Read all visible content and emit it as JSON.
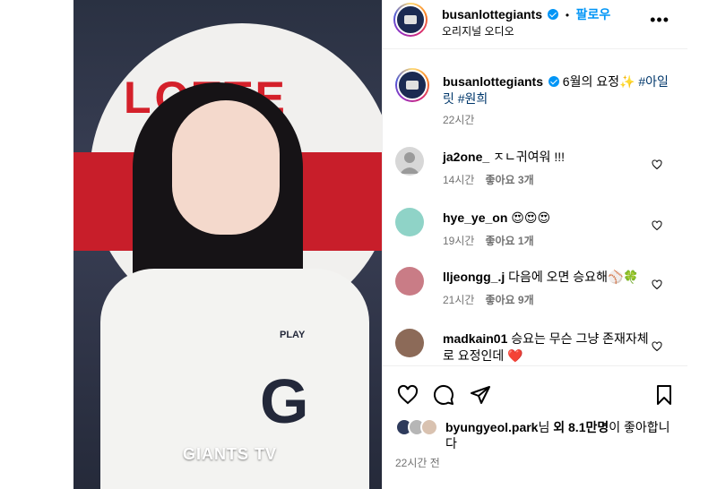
{
  "header": {
    "username": "busanlottegiants",
    "separator": "•",
    "follow_label": "팔로우",
    "audio_label": "오리지널 오디오",
    "more_label": "•••"
  },
  "media": {
    "sign_text": "LOTTE",
    "jersey_brand": "PLAY",
    "jersey_letter": "G",
    "watermark": "GIANTS TV"
  },
  "caption": {
    "username": "busanlottegiants",
    "text": "6월의 요정✨",
    "hashtags": "#아일릿 #원희",
    "time": "22시간"
  },
  "comments": [
    {
      "username": "ja2one_",
      "text": "ㅈㄴ귀여워 !!!",
      "time": "14시간",
      "likes": "좋아요 3개",
      "avatar_color": "#c7c7c7"
    },
    {
      "username": "hye_ye_on",
      "text": "😍😍😍",
      "time": "19시간",
      "likes": "좋아요 1개",
      "avatar_color": "#8fd3c7"
    },
    {
      "username": "lljeongg_.j",
      "text": "다음에 오면 승요해⚾🍀",
      "time": "21시간",
      "likes": "좋아요 9개",
      "avatar_color": "#c97c86"
    },
    {
      "username": "madkain01",
      "text": "승요는 무슨 그냥 존재자체로 요정인데 ❤️",
      "time": "",
      "likes": "",
      "avatar_color": "#8c6a58"
    }
  ],
  "liked_by": {
    "username": "byungyeol.park",
    "mid": "님 ",
    "count": "외 8.1만명",
    "suffix": "이 좋아합니다"
  },
  "posted_time": "22시간 전",
  "colors": {
    "accent": "#0095f6",
    "hashtag": "#00376b",
    "muted": "#737373"
  }
}
